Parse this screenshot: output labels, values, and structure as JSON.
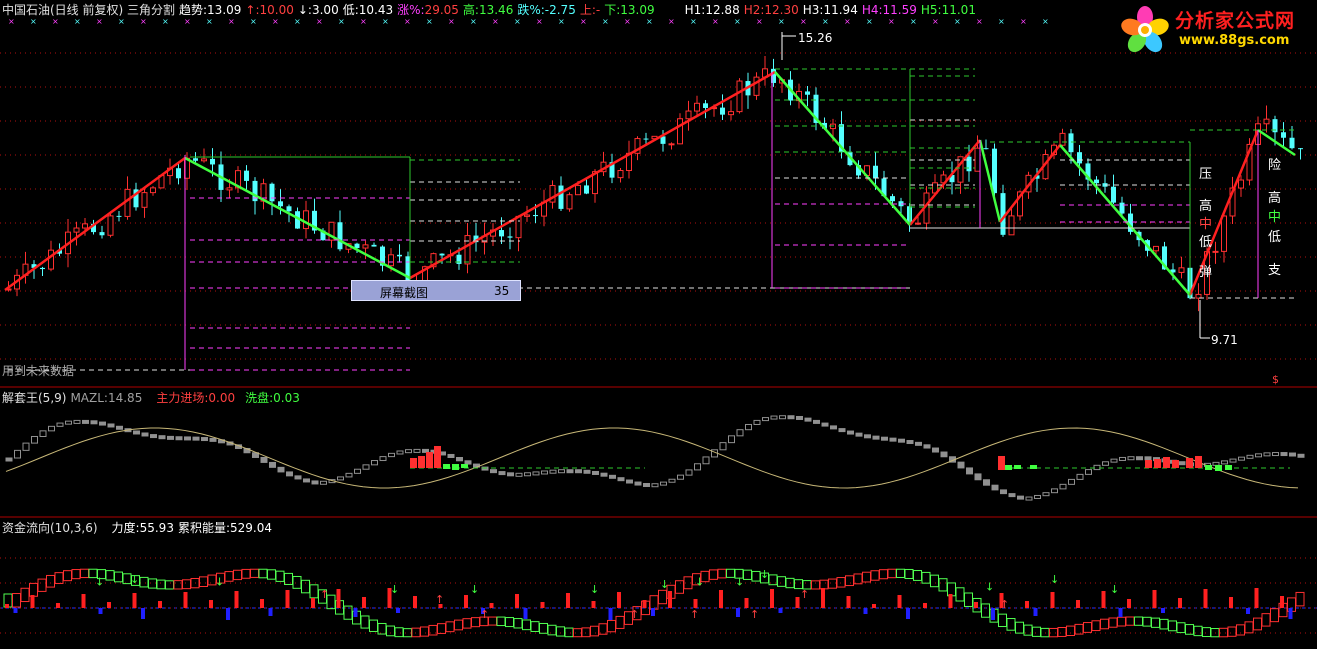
{
  "colors": {
    "up": "#ff3030",
    "down": "#54ffff",
    "bg": "#000000",
    "up_line": "#ff2020",
    "down_line": "#40ff40",
    "magenta": "#ff40ff",
    "green_dash": "#2ec82e",
    "white_dash": "#e0e0e0",
    "grid": "#b01010"
  },
  "logo": {
    "title": "分析家公式网",
    "url": "www.88gs.com",
    "icon": "flower-icon"
  },
  "main": {
    "title": "中国石油(日线 前复权) 三角分割",
    "trend_label": "趋势:",
    "trend_value": "13.09",
    "up_arrow_label": "↑:",
    "up_arrow_value": "10.00",
    "down_arrow_label": "↓:",
    "down_arrow_value": "3.00",
    "low_label": "低:",
    "low_value": "10.43",
    "rise_label": "涨%:",
    "rise_value": "29.05",
    "high_label": "高:",
    "high_value": "13.46",
    "fall_label": "跌%:",
    "fall_value": "-2.75",
    "shang_label": "上:",
    "shang_value": "-",
    "xia_label": "下:",
    "xia_value": "13.09",
    "h1_label": "H1:",
    "h1_value": "12.88",
    "h2_label": "H2:",
    "h2_value": "12.30",
    "h3_label": "H3:",
    "h3_value": "11.94",
    "h4_label": "H4:",
    "h4_value": "11.59",
    "h5_label": "H5:",
    "h5_value": "11.01",
    "peak_label": "15.26",
    "trough_label": "9.71",
    "future_data_note": "用到未来数据",
    "zone_labels": [
      "压",
      "高",
      "中",
      "低",
      "弹"
    ],
    "right_labels": [
      "险",
      "高",
      "中",
      "低",
      "支"
    ],
    "dollar": "$",
    "popup_label": "屏幕截图",
    "popup_value": "35"
  },
  "ind1": {
    "title": "解套王(5,9)",
    "mazl_label": "MAZL:",
    "mazl_value": "14.85",
    "zljc_label": "主力进场:",
    "zljc_value": "0.00",
    "xp_label": "洗盘:",
    "xp_value": "0.03"
  },
  "ind2": {
    "title": "资金流向(10,3,6)",
    "lidu_label": "力度:",
    "lidu_value": "55.93",
    "ljnl_label": "累积能量:",
    "ljnl_value": "529.04"
  },
  "chart_data": {
    "type": "candlestick",
    "title": "中国石油(日线 前复权) 三角分割",
    "turning_points": [
      {
        "label": "15.26",
        "value": 15.26
      },
      {
        "label": "9.71",
        "value": 9.71
      }
    ],
    "h_levels": {
      "H1": 12.88,
      "H2": 12.3,
      "H3": 11.94,
      "H4": 11.59,
      "H5": 11.01
    }
  }
}
